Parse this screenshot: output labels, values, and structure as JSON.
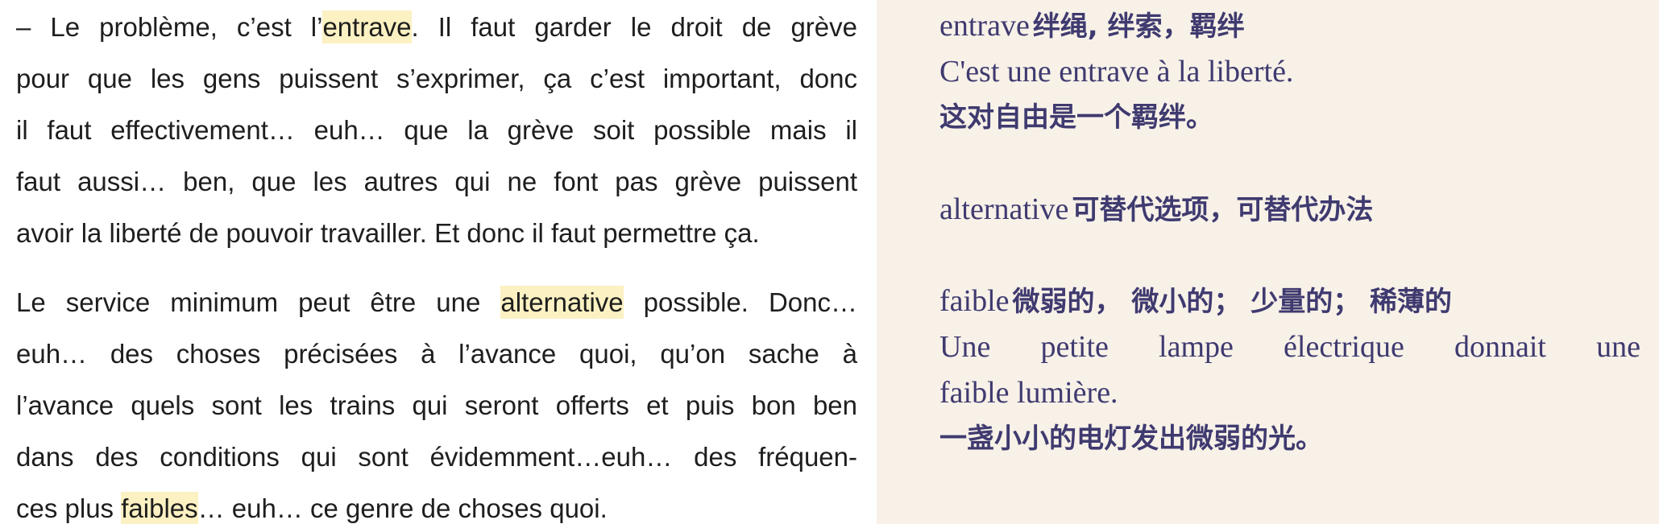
{
  "passage": {
    "p1": {
      "l1_pre": "– Le problème, c’est l’",
      "l1_hl": "entrave",
      "l1_post": ". Il faut garder le droit de grève",
      "l2": "pour que les gens puissent s’exprimer, ça c’est important, donc",
      "l3": "il faut effectivement… euh… que la grève soit possible mais il",
      "l4": "faut aussi… ben, que les autres qui ne font pas grève puissent",
      "l5": "avoir la liberté de pouvoir travailler. Et donc il faut permettre ça."
    },
    "p2": {
      "l1_pre": "Le service minimum peut être une ",
      "l1_hl": "alternative",
      "l1_post": " possible. Donc…",
      "l2": "euh… des choses précisées à l’avance quoi, qu’on sache à",
      "l3": "l’avance quels sont les trains qui seront offerts et puis bon ben",
      "l4": "dans des conditions qui sont évidemment…euh… des fréquen-",
      "l5_pre": "ces plus ",
      "l5_hl": "faibles",
      "l5_post": "… euh… ce genre de choses quoi."
    }
  },
  "vocab": {
    "entrave": {
      "word": "entrave",
      "meaning": "绊绳, 绊索，羁绊",
      "example_fr": "C'est une entrave à la liberté.",
      "example_zh": "这对自由是一个羁绊。"
    },
    "alternative": {
      "word": "alternative",
      "meaning": "可替代选项，可替代办法"
    },
    "faible": {
      "word": "faible",
      "meaning": "微弱的， 微小的； 少量的； 稀薄的",
      "example_fr_1": "Une petite lampe électrique donnait une",
      "example_fr_2": "faible lumière.",
      "example_zh": "一盏小小的电灯发出微弱的光。"
    }
  },
  "colors": {
    "highlight": "#fbf1c2",
    "vocab_text": "#3f3a6f",
    "panel_bg": "#f7f1e8"
  }
}
